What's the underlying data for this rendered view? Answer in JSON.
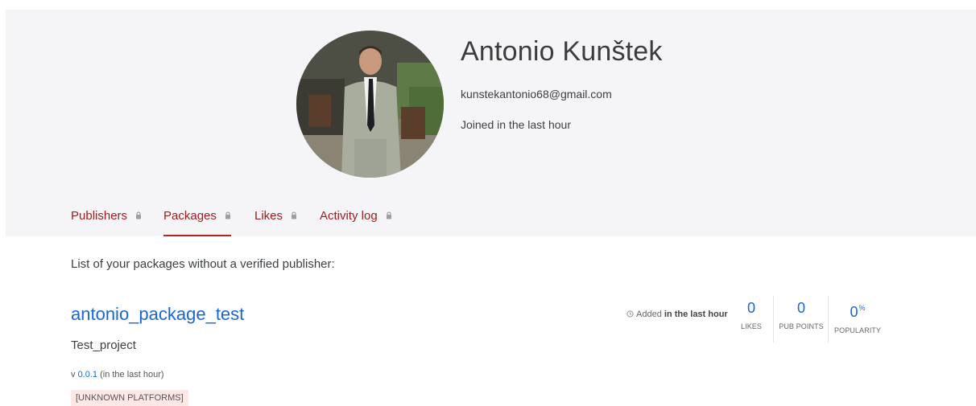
{
  "profile": {
    "name": "Antonio Kunštek",
    "email": "kunstekantonio68@gmail.com",
    "joined": "Joined in the last hour",
    "avatar_icon": "profile-photo"
  },
  "tabs": [
    {
      "label": "Publishers",
      "locked": true,
      "active": false
    },
    {
      "label": "Packages",
      "locked": true,
      "active": true
    },
    {
      "label": "Likes",
      "locked": true,
      "active": false
    },
    {
      "label": "Activity log",
      "locked": true,
      "active": false
    }
  ],
  "content": {
    "intro": "List of your packages without a verified publisher:",
    "package": {
      "title": "antonio_package_test",
      "description": "Test_project",
      "version_prefix": "v ",
      "version": "0.0.1",
      "version_suffix": " (in the last hour)",
      "platforms_badge": "[UNKNOWN PLATFORMS]",
      "added_prefix": "Added ",
      "added_time": "in the last hour",
      "stats": {
        "likes": {
          "value": "0",
          "label": "LIKES"
        },
        "pub_points": {
          "value": "0",
          "label": "PUB POINTS"
        },
        "popularity": {
          "value": "0",
          "unit": "%",
          "label": "POPULARITY"
        }
      }
    }
  },
  "colors": {
    "tab_text": "#9b1c1c",
    "tab_underline": "#b3261e",
    "link": "#1967d2",
    "banner_bg": "#f5f5f7",
    "badge_bg": "#fde8e6"
  }
}
